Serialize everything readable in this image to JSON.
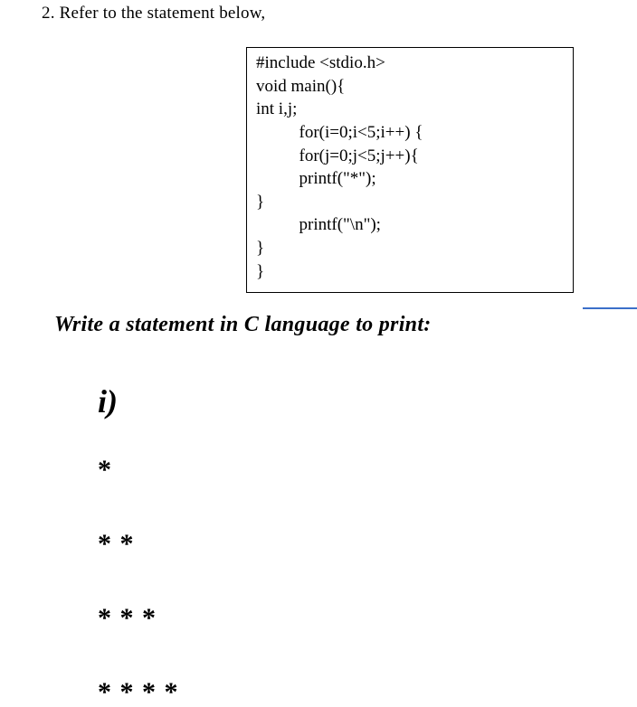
{
  "question": {
    "number": "2.",
    "text": "Refer to the statement below,"
  },
  "code": {
    "lines": [
      "#include <stdio.h>",
      "void main(){",
      "int i,j;",
      "          for(i=0;i<5;i++) {",
      "          for(j=0;j<5;j++){",
      "          printf(\"*\");",
      "}",
      "          printf(\"\\n\");",
      "}",
      "}"
    ]
  },
  "prompt": "Write a statement in C language to print:",
  "part": {
    "label": "i)"
  },
  "pattern": {
    "rows": [
      "*",
      "* *",
      "* * *",
      "* * * *"
    ]
  }
}
